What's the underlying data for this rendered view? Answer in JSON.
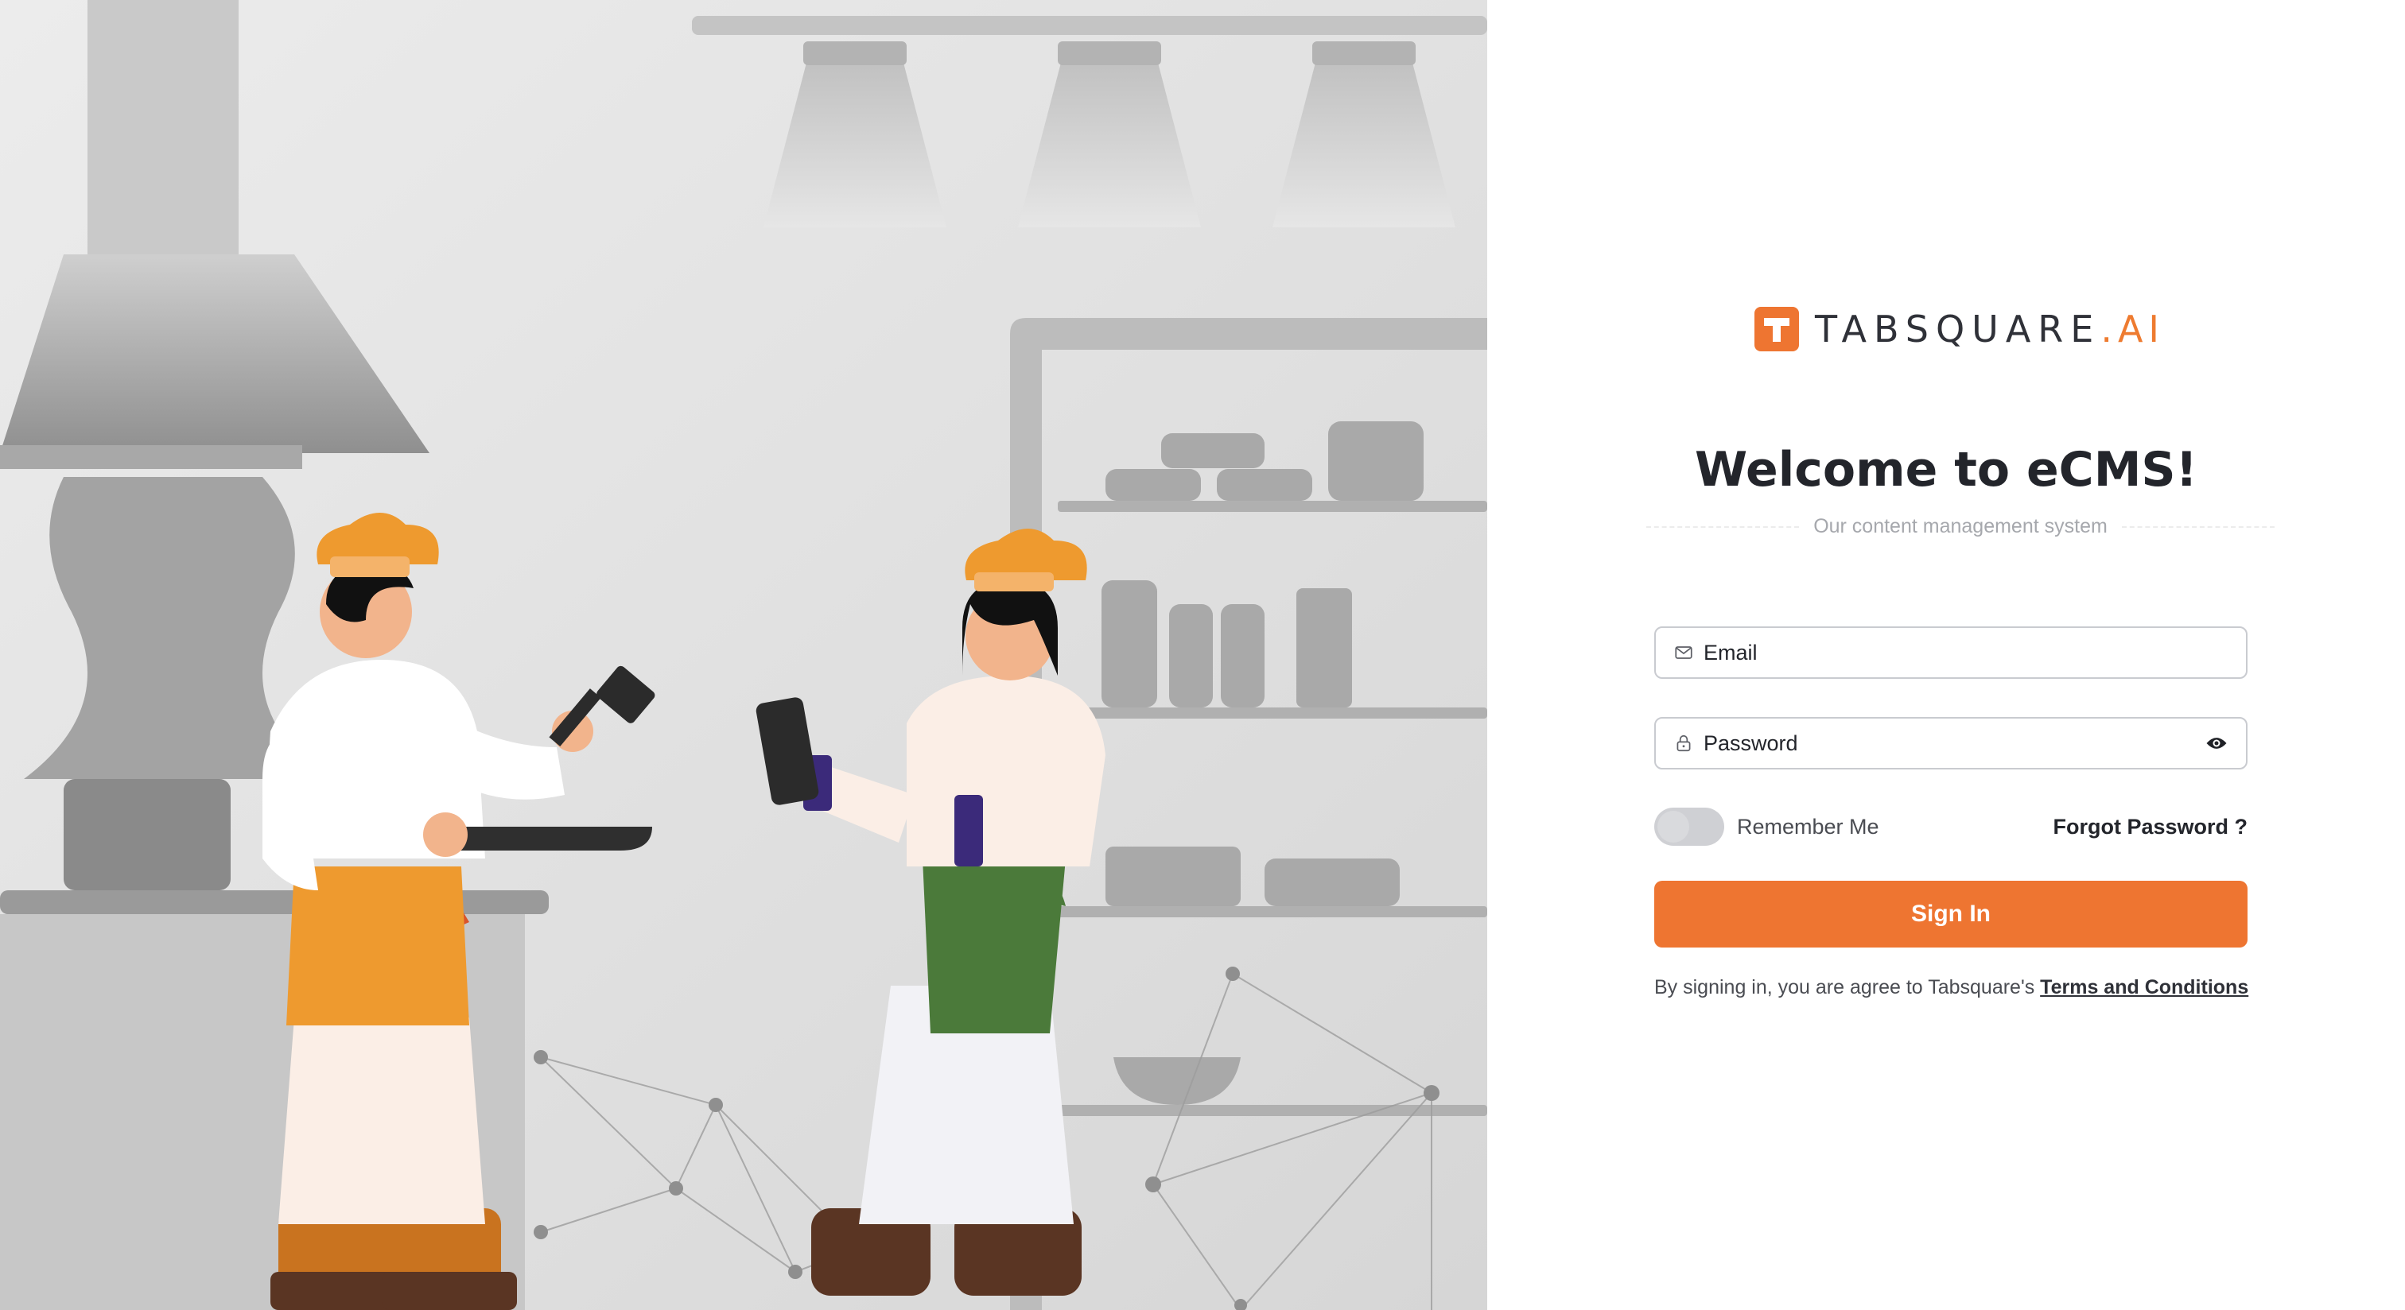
{
  "brand": {
    "name": "TABSQUARE",
    "suffix": ".AI",
    "accent_color": "#ee7531",
    "logo_icon": "tabsquare-logo-icon"
  },
  "login": {
    "title": "Welcome to eCMS!",
    "subtitle": "Our content management system",
    "email": {
      "placeholder": "Email",
      "value": "",
      "icon": "envelope-icon"
    },
    "password": {
      "placeholder": "Password",
      "value": "",
      "icon": "lock-icon",
      "toggle_icon": "eye-icon"
    },
    "remember_me": {
      "label": "Remember Me",
      "checked": false
    },
    "forgot_password_label": "Forgot Password ?",
    "sign_in_label": "Sign In",
    "terms_prefix": "By signing in, you are agree to Tabsquare's ",
    "terms_link": "Terms and Conditions"
  },
  "illustration": {
    "subject": "kitchen-chefs-illustration"
  }
}
